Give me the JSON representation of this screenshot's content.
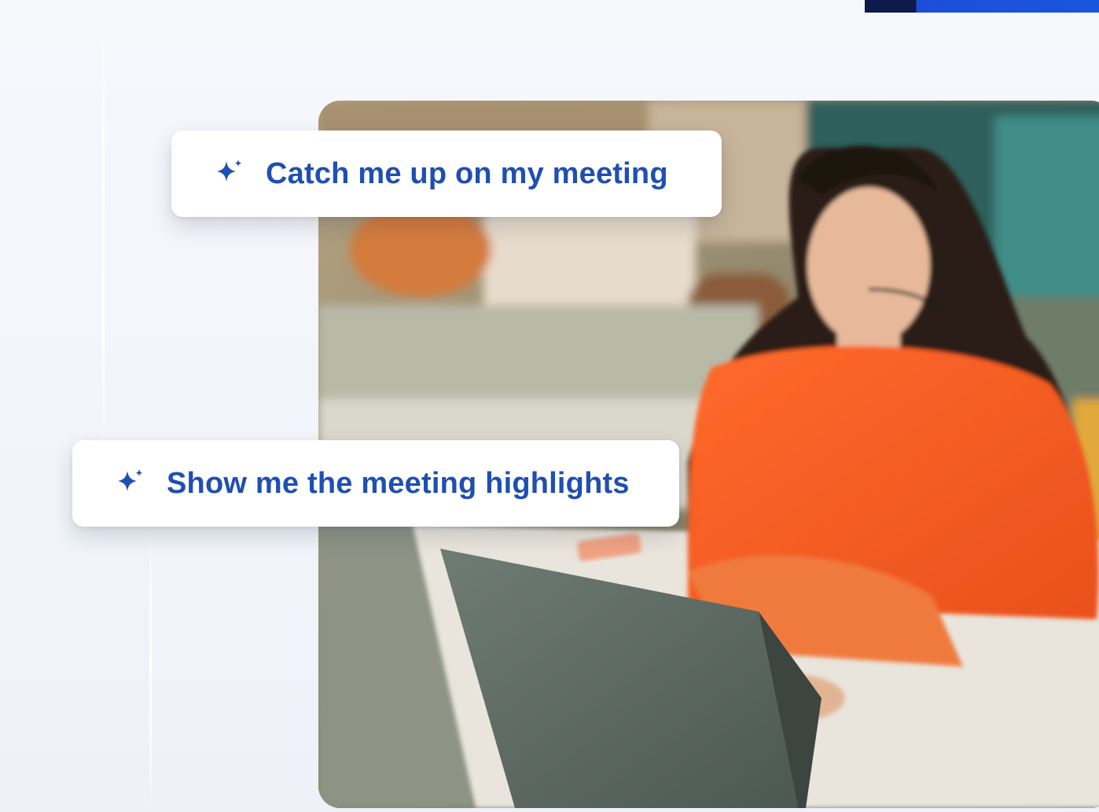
{
  "prompts": [
    {
      "label": "Catch me up on my meeting",
      "icon": "sparkle-icon"
    },
    {
      "label": "Show me the meeting highlights",
      "icon": "sparkle-icon"
    }
  ],
  "hero_image": {
    "subject": "person-with-headset-at-laptop"
  },
  "colors": {
    "accent": "#1f4fb0",
    "top_bar_dark": "#0d1a4a",
    "top_bar_blue": "#1d4ed8",
    "card_background": "#ffffff",
    "page_background": "#f3f5fa"
  }
}
